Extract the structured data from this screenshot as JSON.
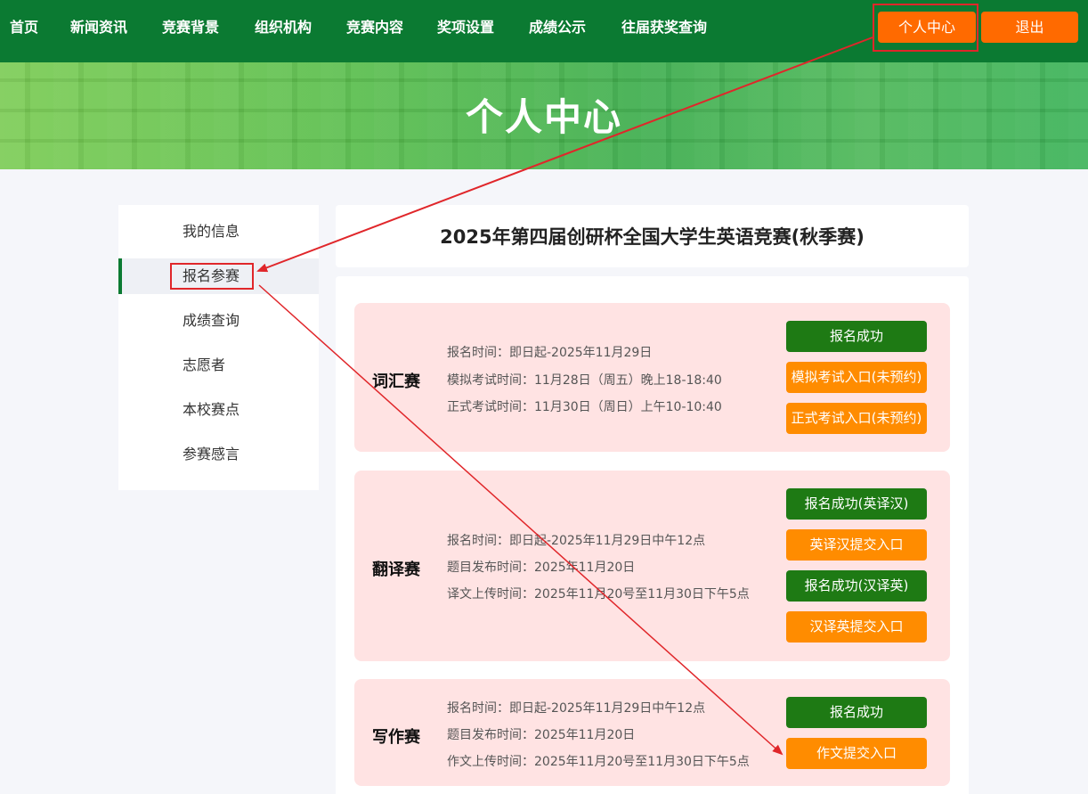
{
  "nav": {
    "items": [
      "首页",
      "新闻资讯",
      "竞赛背景",
      "组织机构",
      "竞赛内容",
      "奖项设置",
      "成绩公示",
      "往届获奖查询"
    ],
    "personal_center": "个人中心",
    "logout": "退出"
  },
  "banner": {
    "title": "个人中心"
  },
  "sidebar": {
    "items": [
      "我的信息",
      "报名参赛",
      "成绩查询",
      "志愿者",
      "本校赛点",
      "参赛感言"
    ],
    "active": "报名参赛"
  },
  "main": {
    "title": "2025年第四届创研杯全国大学生英语竞赛(秋季赛)",
    "cards": [
      {
        "name": "词汇赛",
        "lines": [
          "报名时间：即日起-2025年11月29日",
          "模拟考试时间：11月28日（周五）晚上18-18:40",
          "正式考试时间：11月30日（周日）上午10-10:40"
        ],
        "buttons": [
          "报名成功",
          "模拟考试入口(未预约)",
          "正式考试入口(未预约)"
        ]
      },
      {
        "name": "翻译赛",
        "lines": [
          "报名时间：即日起-2025年11月29日中午12点",
          "题目发布时间：2025年11月20日",
          "译文上传时间：2025年11月20号至11月30日下午5点"
        ],
        "buttons": [
          "报名成功(英译汉)",
          "英译汉提交入口",
          "报名成功(汉译英)",
          "汉译英提交入口"
        ]
      },
      {
        "name": "写作赛",
        "lines": [
          "报名时间：即日起-2025年11月29日中午12点",
          "题目发布时间：2025年11月20日",
          "作文上传时间：2025年11月20号至11月30日下午5点"
        ],
        "buttons": [
          "报名成功",
          "作文提交入口"
        ]
      }
    ]
  },
  "colors": {
    "nav_green": "#0b7a32",
    "orange": "#ff6a00",
    "button_green": "#1e7a14",
    "button_orange": "#ff8c00",
    "card_pink": "#ffe3e3",
    "annotation_red": "#e0262a"
  }
}
